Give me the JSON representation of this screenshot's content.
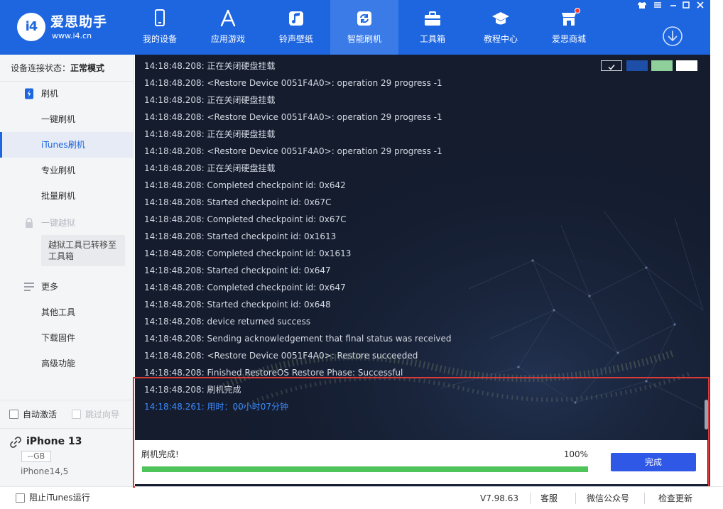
{
  "app": {
    "brand_name": "爱思助手",
    "brand_url": "www.i4.cn",
    "logo_glyph": "i4"
  },
  "nav": {
    "items": [
      {
        "label": "我的设备",
        "icon": "phone-icon"
      },
      {
        "label": "应用游戏",
        "icon": "app-store-icon"
      },
      {
        "label": "铃声壁纸",
        "icon": "music-note-icon"
      },
      {
        "label": "智能刷机",
        "icon": "refresh-icon",
        "active": true
      },
      {
        "label": "工具箱",
        "icon": "toolbox-icon"
      },
      {
        "label": "教程中心",
        "icon": "graduation-cap-icon"
      },
      {
        "label": "爱思商城",
        "icon": "shop-icon",
        "badge": true
      }
    ]
  },
  "window_controls": [
    "shirt-icon",
    "menu-icon",
    "minimize-icon",
    "maximize-icon",
    "close-icon"
  ],
  "sidebar": {
    "connection_label": "设备连接状态：",
    "connection_value": "正常模式",
    "flash_group": "刷机",
    "flash_items": [
      "一键刷机",
      "iTunes刷机",
      "专业刷机",
      "批量刷机"
    ],
    "active_item": "iTunes刷机",
    "jailbreak_group": "一键越狱",
    "jailbreak_note": "越狱工具已转移至工具箱",
    "more_group": "更多",
    "more_items": [
      "其他工具",
      "下载固件",
      "高级功能"
    ],
    "auto_activate": "自动激活",
    "skip_guide": "跳过向导"
  },
  "device": {
    "name": "iPhone 13",
    "storage": "--GB",
    "model": "iPhone14,5"
  },
  "log": {
    "lines": [
      "14:18:48.208:  正在关闭硬盘挂载",
      "14:18:48.208: <Restore Device 0051F4A0>: operation 29 progress -1",
      "14:18:48.208:  正在关闭硬盘挂载",
      "14:18:48.208: <Restore Device 0051F4A0>: operation 29 progress -1",
      "14:18:48.208:  正在关闭硬盘挂载",
      "14:18:48.208: <Restore Device 0051F4A0>: operation 29 progress -1",
      "14:18:48.208:  正在关闭硬盘挂载",
      "14:18:48.208: Completed checkpoint id: 0x642",
      "14:18:48.208: Started checkpoint id: 0x67C",
      "14:18:48.208: Completed checkpoint id: 0x67C",
      "14:18:48.208: Started checkpoint id: 0x1613",
      "14:18:48.208: Completed checkpoint id: 0x1613",
      "14:18:48.208: Started checkpoint id: 0x647",
      "14:18:48.208: Completed checkpoint id: 0x647",
      "14:18:48.208: Started checkpoint id: 0x648",
      "14:18:48.208: device returned success",
      "14:18:48.208: Sending acknowledgement that final status was received",
      "14:18:48.208: <Restore Device 0051F4A0>: Restore succeeded",
      "14:18:48.208: Finished RestoreOS Restore Phase: Successful",
      "14:18:48.208:  刷机完成",
      "14:18:48.261:  用时：00小时07分钟"
    ],
    "highlight_index": 20,
    "highlight_color": "#3d8bff",
    "swatch_colors": [
      "#141c2e",
      "#1e4fa8",
      "#8fcf9a",
      "#ffffff"
    ]
  },
  "progress": {
    "title": "刷机完成!",
    "percent_text": "100%",
    "fraction": 1.0,
    "done_label": "完成",
    "bar_color": "#4ec45a"
  },
  "statusbar": {
    "block_itunes": "阻止iTunes运行",
    "version": "V7.98.63",
    "support": "客服",
    "wechat": "微信公众号",
    "check_update": "检查更新"
  },
  "colors": {
    "brand_blue": "#1e66e0",
    "log_bg": "#141c2e",
    "alert_red": "#d93a3a"
  }
}
